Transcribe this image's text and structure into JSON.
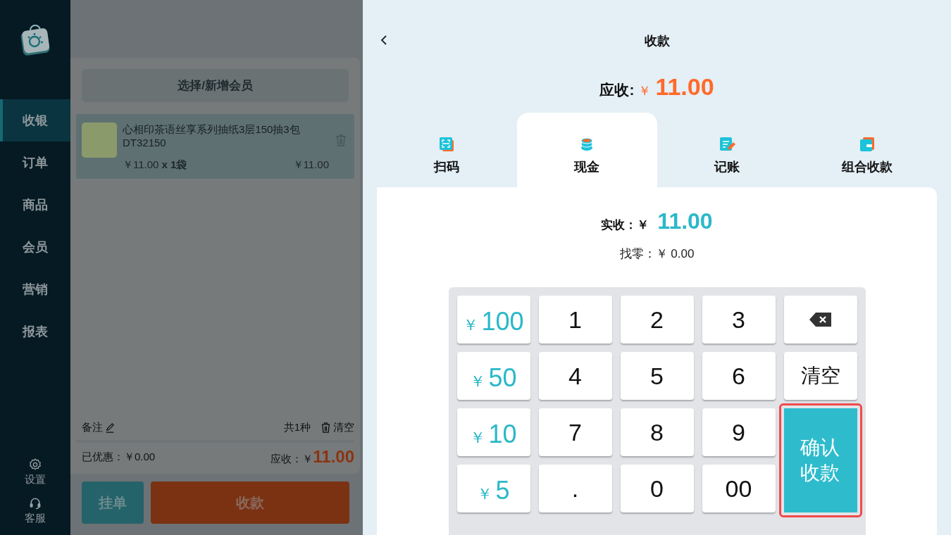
{
  "sidebar": {
    "nav": [
      {
        "label": "收银",
        "selected": true
      },
      {
        "label": "订单",
        "selected": false
      },
      {
        "label": "商品",
        "selected": false
      },
      {
        "label": "会员",
        "selected": false
      },
      {
        "label": "营销",
        "selected": false
      },
      {
        "label": "报表",
        "selected": false
      }
    ],
    "bottom": [
      {
        "kind": "settings",
        "label": "设置"
      },
      {
        "kind": "support",
        "label": "客服"
      }
    ]
  },
  "cart": {
    "member_button": "选择/新增会员",
    "items": [
      {
        "name": "心相印茶语丝享系列抽纸3层150抽3包DT32150",
        "unit_price": "￥11.00",
        "quantity": "x 1袋",
        "subtotal": "￥11.00"
      }
    ],
    "note": "备注",
    "count": "共1种",
    "clear": "清空",
    "discount_label": "已优惠：",
    "discount": "￥0.00",
    "due_label": "应收：",
    "due_currency": "￥",
    "due": "11.00",
    "hold_button": "挂单",
    "pay_button": "收款"
  },
  "payment": {
    "title": "收款",
    "due_label": "应收:",
    "due_currency": "￥",
    "due": "11.00",
    "tabs": [
      {
        "kind": "scan",
        "label": "扫码",
        "selected": false
      },
      {
        "kind": "cash",
        "label": "现金",
        "selected": true
      },
      {
        "kind": "credit",
        "label": "记账",
        "selected": false
      },
      {
        "kind": "combined",
        "label": "组合收款",
        "selected": false
      }
    ],
    "received_label": "实收：",
    "received_currency": "￥",
    "received": "11.00",
    "change_label": "找零：",
    "change": "￥ 0.00",
    "keys": [
      {
        "kind": "amount",
        "currency": "￥",
        "label": "100",
        "highlighted": false
      },
      {
        "kind": "digit",
        "label": "1",
        "highlighted": false
      },
      {
        "kind": "digit",
        "label": "2",
        "highlighted": false
      },
      {
        "kind": "digit",
        "label": "3",
        "highlighted": false
      },
      {
        "kind": "backspace",
        "highlighted": false
      },
      {
        "kind": "amount",
        "currency": "￥",
        "label": "50",
        "highlighted": false
      },
      {
        "kind": "digit",
        "label": "4",
        "highlighted": false
      },
      {
        "kind": "digit",
        "label": "5",
        "highlighted": false
      },
      {
        "kind": "digit",
        "label": "6",
        "highlighted": false
      },
      {
        "kind": "clear",
        "label": "清空",
        "highlighted": false
      },
      {
        "kind": "amount",
        "currency": "￥",
        "label": "10",
        "highlighted": false
      },
      {
        "kind": "digit",
        "label": "7",
        "highlighted": false
      },
      {
        "kind": "digit",
        "label": "8",
        "highlighted": false
      },
      {
        "kind": "digit",
        "label": "9",
        "highlighted": false
      },
      {
        "kind": "confirm",
        "label": "确认收款",
        "highlighted": true
      },
      {
        "kind": "amount",
        "currency": "￥",
        "label": "5",
        "highlighted": false
      },
      {
        "kind": "digit",
        "label": ".",
        "highlighted": false
      },
      {
        "kind": "digit",
        "label": "0",
        "highlighted": false
      },
      {
        "kind": "digit",
        "label": "00",
        "highlighted": false
      }
    ]
  }
}
